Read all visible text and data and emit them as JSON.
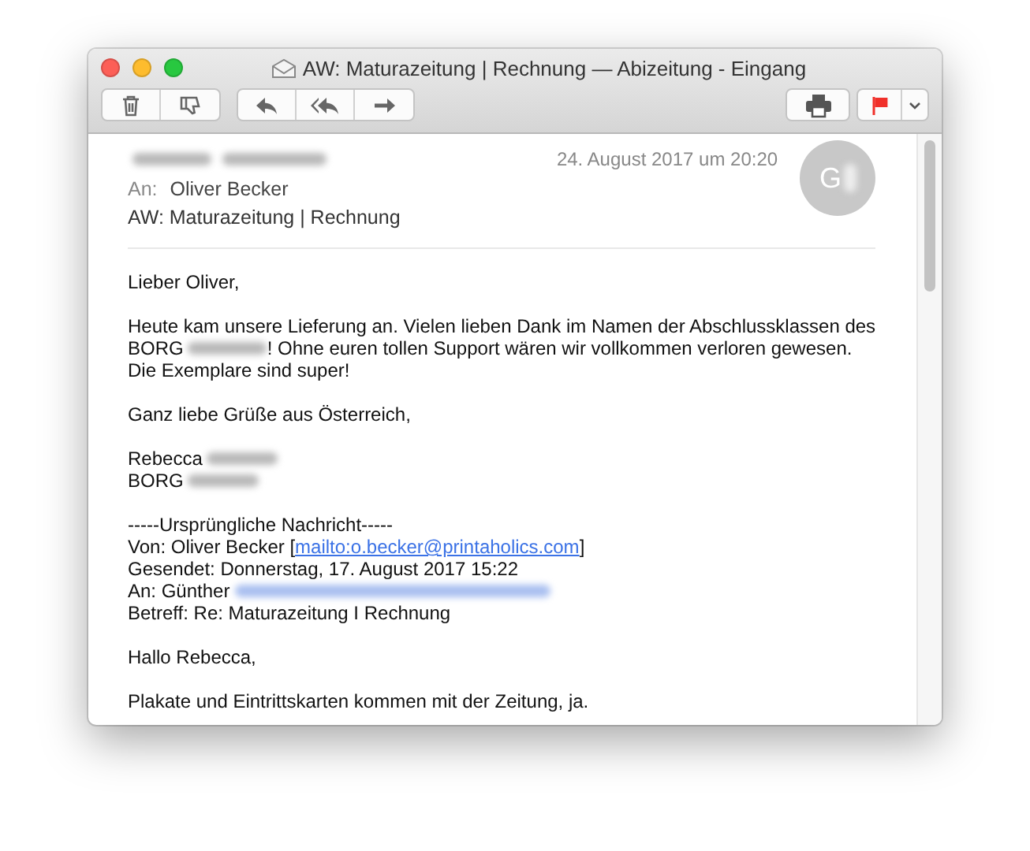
{
  "window": {
    "title": "AW: Maturazeitung | Rechnung — Abizeitung - Eingang"
  },
  "toolbar": {
    "groups": [
      {
        "buttons": [
          {
            "kind": "trash"
          },
          {
            "kind": "junk"
          }
        ]
      },
      {
        "buttons": [
          {
            "kind": "reply"
          },
          {
            "kind": "reply_all"
          },
          {
            "kind": "forward"
          }
        ]
      }
    ],
    "print": {
      "kind": "print"
    },
    "flag": {
      "color": "#f0302a"
    }
  },
  "header": {
    "date": "24. August 2017 um 20:20",
    "to_label": "An:",
    "to": "Oliver Becker",
    "subject": "AW: Maturazeitung | Rechnung",
    "avatar": "G"
  },
  "body": [
    {
      "lines": [
        [
          {
            "kind": "text",
            "text": "Lieber Oliver,"
          }
        ]
      ]
    },
    {
      "lines": [
        [
          {
            "kind": "text",
            "text": "Heute kam unsere Lieferung an. Vielen lieben Dank im Namen der Abschlussklassen des"
          }
        ],
        [
          {
            "kind": "text",
            "text": "BORG"
          },
          {
            "kind": "redacted"
          },
          {
            "kind": "text",
            "text": "! Ohne euren tollen Support wären wir vollkommen verloren gewesen."
          }
        ],
        [
          {
            "kind": "text",
            "text": "Die Exemplare sind super!"
          }
        ]
      ]
    },
    {
      "lines": [
        [
          {
            "kind": "text",
            "text": "Ganz liebe Grüße aus Österreich,"
          }
        ]
      ]
    },
    {
      "lines": [
        [
          {
            "kind": "text",
            "text": "Rebecca"
          },
          {
            "kind": "redacted"
          }
        ],
        [
          {
            "kind": "text",
            "text": "BORG"
          },
          {
            "kind": "redacted"
          }
        ]
      ]
    },
    {
      "lines": [
        [
          {
            "kind": "text",
            "text": "-----Ursprüngliche Nachricht-----"
          }
        ],
        [
          {
            "kind": "text",
            "text": "Von: Oliver Becker ["
          },
          {
            "kind": "link",
            "text": "mailto:o.becker@printaholics.com"
          },
          {
            "kind": "text",
            "text": "]"
          }
        ],
        [
          {
            "kind": "text",
            "text": "Gesendet: Donnerstag, 17. August 2017 15:22"
          }
        ],
        [
          {
            "kind": "text",
            "text": "An: Günther"
          },
          {
            "kind": "redacted_link"
          }
        ],
        [
          {
            "kind": "text",
            "text": "Betreff: Re: Maturazeitung I Rechnung"
          }
        ]
      ]
    },
    {
      "lines": [
        [
          {
            "kind": "text",
            "text": "Hallo Rebecca,"
          }
        ]
      ]
    },
    {
      "lines": [
        [
          {
            "kind": "text",
            "text": "Plakate und Eintrittskarten kommen mit der Zeitung, ja."
          }
        ]
      ]
    }
  ]
}
